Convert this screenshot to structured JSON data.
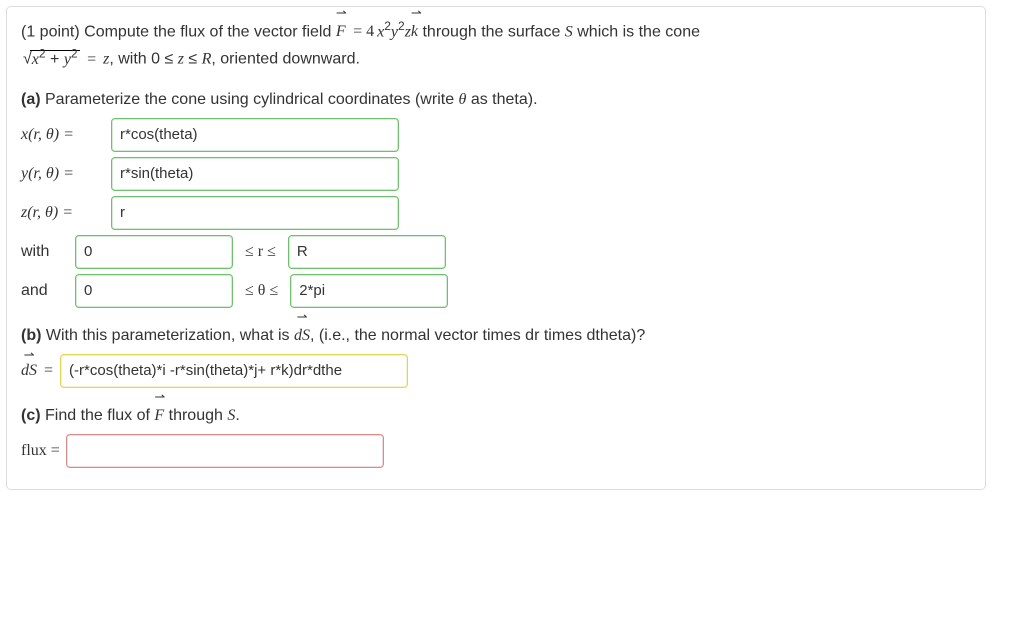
{
  "problem": {
    "points_prefix": "(1 point) Compute the flux of the vector field ",
    "F_symbol": "F",
    "eq1": " = 4",
    "through": " through the surface ",
    "S": "S",
    "which_is": " which is the cone ",
    "eq_z": " = ",
    "z_var": "z",
    "with_text": ", with 0 ≤ ",
    "leq_R": " ≤ ",
    "R": "R",
    "oriented": ", oriented downward."
  },
  "partA": {
    "heading_bold": "(a)",
    "heading_rest": " Parameterize the cone using cylindrical coordinates (write ",
    "theta_sym": "θ",
    "heading_end": " as theta).",
    "x_label": "x(r, θ) = ",
    "x_val": "r*cos(theta)",
    "y_label": "y(r, θ) = ",
    "y_val": "r*sin(theta)",
    "z_label": "z(r, θ) = ",
    "z_val": "r",
    "with": "with",
    "r_low": "0",
    "r_mid": " ≤ r ≤ ",
    "r_high": "R",
    "and": "and",
    "t_low": "0",
    "t_mid": " ≤ θ ≤ ",
    "t_high": "2*pi"
  },
  "partB": {
    "heading_bold": "(b)",
    "heading_rest": " With this parameterization, what is ",
    "dS_sym": "dS",
    "heading_end": ", (i.e., the normal vector times dr times dtheta)?",
    "label": "dS",
    "eq": " = ",
    "val": "(-r*cos(theta)*i -r*sin(theta)*j+ r*k)dr*dthe"
  },
  "partC": {
    "heading_bold": "(c)",
    "heading_rest": " Find the flux of ",
    "F_sym": "F",
    "heading_end": " through ",
    "S": "S",
    "period": ".",
    "label": "flux =",
    "val": ""
  }
}
